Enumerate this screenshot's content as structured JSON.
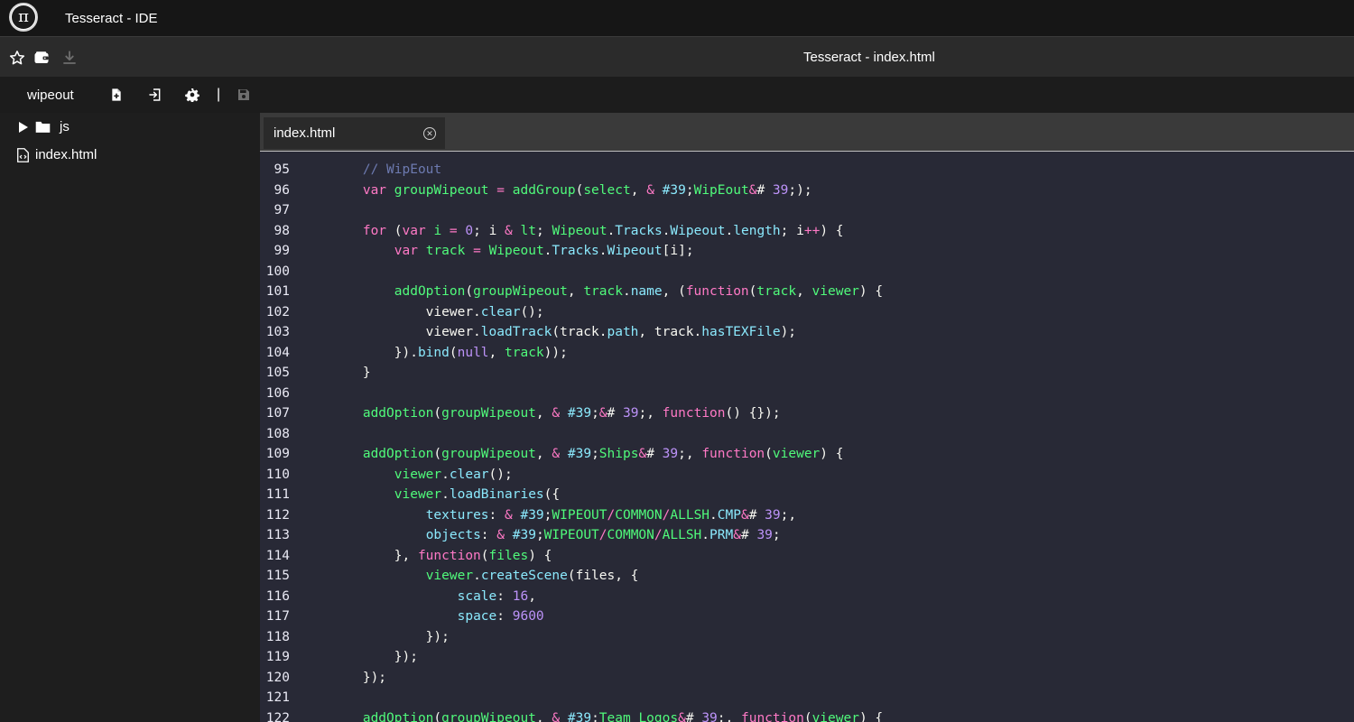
{
  "app": {
    "title": "Tesseract - IDE",
    "logo_glyph": "π"
  },
  "toolbar": {
    "document_title": "Tesseract - index.html",
    "icons": [
      "star-icon",
      "wallet-icon",
      "download-icon"
    ]
  },
  "project": {
    "name": "wipeout",
    "separator": "|",
    "icons": [
      "new-file-icon",
      "import-icon",
      "gear-icon",
      "save-icon"
    ]
  },
  "file_tree": [
    {
      "type": "folder",
      "label": "js"
    },
    {
      "type": "file",
      "label": "index.html"
    }
  ],
  "tabs": [
    {
      "label": "index.html",
      "active": true
    }
  ],
  "colors": {
    "keyword": "#ff79c6",
    "definition": "#50fa7b",
    "property": "#8be9fd",
    "string": "#f1fa8c",
    "number": "#bd93f9",
    "comment": "#6d7ab0",
    "plain": "#f8f8f2",
    "editor_background": "#282936"
  },
  "code": {
    "first_line": 95,
    "lines": [
      [
        [
          "com",
          "        // WipEout"
        ]
      ],
      [
        [
          "pl",
          "        "
        ],
        [
          "kw",
          "var"
        ],
        [
          "pl",
          " "
        ],
        [
          "def",
          "groupWipeout"
        ],
        [
          "pl",
          " "
        ],
        [
          "kw",
          "="
        ],
        [
          "pl",
          " "
        ],
        [
          "def",
          "addGroup"
        ],
        [
          "pl",
          "("
        ],
        [
          "def",
          "select"
        ],
        [
          "pl",
          ", "
        ],
        [
          "kw",
          "&"
        ],
        [
          "pl",
          " "
        ],
        [
          "prop",
          "#39"
        ],
        [
          "pl",
          ";"
        ],
        [
          "def",
          "WipEout"
        ],
        [
          "kw",
          "&"
        ],
        [
          "pl",
          "# "
        ],
        [
          "num",
          "39"
        ],
        [
          "pl",
          ";);"
        ]
      ],
      [
        [
          "pl",
          ""
        ]
      ],
      [
        [
          "pl",
          "        "
        ],
        [
          "kw",
          "for"
        ],
        [
          "pl",
          " ("
        ],
        [
          "kw",
          "var"
        ],
        [
          "pl",
          " "
        ],
        [
          "def",
          "i"
        ],
        [
          "pl",
          " "
        ],
        [
          "kw",
          "="
        ],
        [
          "pl",
          " "
        ],
        [
          "num",
          "0"
        ],
        [
          "pl",
          "; i "
        ],
        [
          "kw",
          "&"
        ],
        [
          "pl",
          " "
        ],
        [
          "def",
          "lt"
        ],
        [
          "pl",
          "; "
        ],
        [
          "def",
          "Wipeout"
        ],
        [
          "pl",
          "."
        ],
        [
          "prop",
          "Tracks"
        ],
        [
          "pl",
          "."
        ],
        [
          "prop",
          "Wipeout"
        ],
        [
          "pl",
          "."
        ],
        [
          "prop",
          "length"
        ],
        [
          "pl",
          "; i"
        ],
        [
          "kw",
          "++"
        ],
        [
          "pl",
          ") {"
        ]
      ],
      [
        [
          "pl",
          "            "
        ],
        [
          "kw",
          "var"
        ],
        [
          "pl",
          " "
        ],
        [
          "def",
          "track"
        ],
        [
          "pl",
          " "
        ],
        [
          "kw",
          "="
        ],
        [
          "pl",
          " "
        ],
        [
          "def",
          "Wipeout"
        ],
        [
          "pl",
          "."
        ],
        [
          "prop",
          "Tracks"
        ],
        [
          "pl",
          "."
        ],
        [
          "prop",
          "Wipeout"
        ],
        [
          "pl",
          "[i];"
        ]
      ],
      [
        [
          "pl",
          ""
        ]
      ],
      [
        [
          "pl",
          "            "
        ],
        [
          "def",
          "addOption"
        ],
        [
          "pl",
          "("
        ],
        [
          "def",
          "groupWipeout"
        ],
        [
          "pl",
          ", "
        ],
        [
          "def",
          "track"
        ],
        [
          "pl",
          "."
        ],
        [
          "prop",
          "name"
        ],
        [
          "pl",
          ", ("
        ],
        [
          "kw",
          "function"
        ],
        [
          "pl",
          "("
        ],
        [
          "def",
          "track"
        ],
        [
          "pl",
          ", "
        ],
        [
          "def",
          "viewer"
        ],
        [
          "pl",
          ") {"
        ]
      ],
      [
        [
          "pl",
          "                viewer."
        ],
        [
          "prop",
          "clear"
        ],
        [
          "pl",
          "();"
        ]
      ],
      [
        [
          "pl",
          "                viewer."
        ],
        [
          "prop",
          "loadTrack"
        ],
        [
          "pl",
          "(track."
        ],
        [
          "prop",
          "path"
        ],
        [
          "pl",
          ", track."
        ],
        [
          "prop",
          "hasTEXFile"
        ],
        [
          "pl",
          ");"
        ]
      ],
      [
        [
          "pl",
          "            })."
        ],
        [
          "prop",
          "bind"
        ],
        [
          "pl",
          "("
        ],
        [
          "num",
          "null"
        ],
        [
          "pl",
          ", "
        ],
        [
          "def",
          "track"
        ],
        [
          "pl",
          "));"
        ]
      ],
      [
        [
          "pl",
          "        }"
        ]
      ],
      [
        [
          "pl",
          ""
        ]
      ],
      [
        [
          "pl",
          "        "
        ],
        [
          "def",
          "addOption"
        ],
        [
          "pl",
          "("
        ],
        [
          "def",
          "groupWipeout"
        ],
        [
          "pl",
          ", "
        ],
        [
          "kw",
          "&"
        ],
        [
          "pl",
          " "
        ],
        [
          "prop",
          "#39"
        ],
        [
          "pl",
          ";"
        ],
        [
          "kw",
          "&"
        ],
        [
          "pl",
          "# "
        ],
        [
          "num",
          "39"
        ],
        [
          "pl",
          ";, "
        ],
        [
          "kw",
          "function"
        ],
        [
          "pl",
          "() {});"
        ]
      ],
      [
        [
          "pl",
          ""
        ]
      ],
      [
        [
          "pl",
          "        "
        ],
        [
          "def",
          "addOption"
        ],
        [
          "pl",
          "("
        ],
        [
          "def",
          "groupWipeout"
        ],
        [
          "pl",
          ", "
        ],
        [
          "kw",
          "&"
        ],
        [
          "pl",
          " "
        ],
        [
          "prop",
          "#39"
        ],
        [
          "pl",
          ";"
        ],
        [
          "def",
          "Ships"
        ],
        [
          "kw",
          "&"
        ],
        [
          "pl",
          "# "
        ],
        [
          "num",
          "39"
        ],
        [
          "pl",
          ";, "
        ],
        [
          "kw",
          "function"
        ],
        [
          "pl",
          "("
        ],
        [
          "def",
          "viewer"
        ],
        [
          "pl",
          ") {"
        ]
      ],
      [
        [
          "pl",
          "            "
        ],
        [
          "def",
          "viewer"
        ],
        [
          "pl",
          "."
        ],
        [
          "prop",
          "clear"
        ],
        [
          "pl",
          "();"
        ]
      ],
      [
        [
          "pl",
          "            "
        ],
        [
          "def",
          "viewer"
        ],
        [
          "pl",
          "."
        ],
        [
          "prop",
          "loadBinaries"
        ],
        [
          "pl",
          "({"
        ]
      ],
      [
        [
          "pl",
          "                "
        ],
        [
          "prop",
          "textures"
        ],
        [
          "pl",
          ": "
        ],
        [
          "kw",
          "&"
        ],
        [
          "pl",
          " "
        ],
        [
          "prop",
          "#39"
        ],
        [
          "pl",
          ";"
        ],
        [
          "def",
          "WIPEOUT"
        ],
        [
          "kw",
          "/"
        ],
        [
          "def",
          "COMMON"
        ],
        [
          "kw",
          "/"
        ],
        [
          "def",
          "ALLSH"
        ],
        [
          "pl",
          "."
        ],
        [
          "prop",
          "CMP"
        ],
        [
          "kw",
          "&"
        ],
        [
          "pl",
          "# "
        ],
        [
          "num",
          "39"
        ],
        [
          "pl",
          ";,"
        ]
      ],
      [
        [
          "pl",
          "                "
        ],
        [
          "prop",
          "objects"
        ],
        [
          "pl",
          ": "
        ],
        [
          "kw",
          "&"
        ],
        [
          "pl",
          " "
        ],
        [
          "prop",
          "#39"
        ],
        [
          "pl",
          ";"
        ],
        [
          "def",
          "WIPEOUT"
        ],
        [
          "kw",
          "/"
        ],
        [
          "def",
          "COMMON"
        ],
        [
          "kw",
          "/"
        ],
        [
          "def",
          "ALLSH"
        ],
        [
          "pl",
          "."
        ],
        [
          "prop",
          "PRM"
        ],
        [
          "kw",
          "&"
        ],
        [
          "pl",
          "# "
        ],
        [
          "num",
          "39"
        ],
        [
          "pl",
          ";"
        ]
      ],
      [
        [
          "pl",
          "            }, "
        ],
        [
          "kw",
          "function"
        ],
        [
          "pl",
          "("
        ],
        [
          "def",
          "files"
        ],
        [
          "pl",
          ") {"
        ]
      ],
      [
        [
          "pl",
          "                "
        ],
        [
          "def",
          "viewer"
        ],
        [
          "pl",
          "."
        ],
        [
          "prop",
          "createScene"
        ],
        [
          "pl",
          "(files, {"
        ]
      ],
      [
        [
          "pl",
          "                    "
        ],
        [
          "prop",
          "scale"
        ],
        [
          "pl",
          ": "
        ],
        [
          "num",
          "16"
        ],
        [
          "pl",
          ","
        ]
      ],
      [
        [
          "pl",
          "                    "
        ],
        [
          "prop",
          "space"
        ],
        [
          "pl",
          ": "
        ],
        [
          "num",
          "9600"
        ]
      ],
      [
        [
          "pl",
          "                });"
        ]
      ],
      [
        [
          "pl",
          "            });"
        ]
      ],
      [
        [
          "pl",
          "        });"
        ]
      ],
      [
        [
          "pl",
          ""
        ]
      ],
      [
        [
          "pl",
          "        "
        ],
        [
          "def",
          "addOption"
        ],
        [
          "pl",
          "("
        ],
        [
          "def",
          "groupWipeout"
        ],
        [
          "pl",
          ", "
        ],
        [
          "kw",
          "&"
        ],
        [
          "pl",
          " "
        ],
        [
          "prop",
          "#39"
        ],
        [
          "pl",
          ";"
        ],
        [
          "def",
          "Team Logos"
        ],
        [
          "kw",
          "&"
        ],
        [
          "pl",
          "# "
        ],
        [
          "num",
          "39"
        ],
        [
          "pl",
          ";, "
        ],
        [
          "kw",
          "function"
        ],
        [
          "pl",
          "("
        ],
        [
          "def",
          "viewer"
        ],
        [
          "pl",
          ") {"
        ]
      ]
    ]
  }
}
